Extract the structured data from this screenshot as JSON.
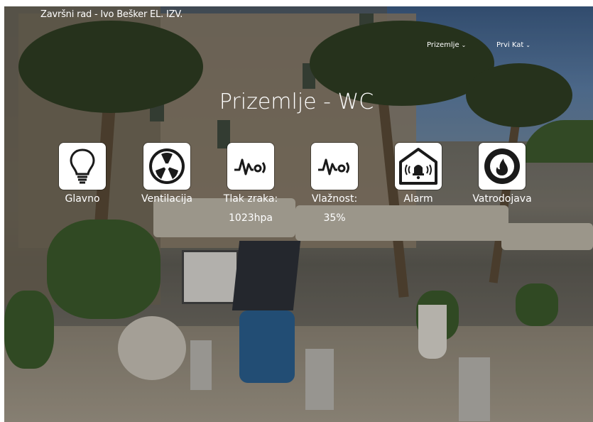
{
  "header": {
    "site_title": "Završni rad - Ivo Bešker EL. IZV.",
    "nav": [
      {
        "label": "Prizemlje"
      },
      {
        "label": "Prvi Kat"
      }
    ]
  },
  "main": {
    "page_title": "Prizemlje - WC",
    "tiles": [
      {
        "icon": "lightbulb-icon",
        "label": "Glavno",
        "value": ""
      },
      {
        "icon": "fan-icon",
        "label": "Ventilacija",
        "value": ""
      },
      {
        "icon": "pressure-wave-icon",
        "label": "Tlak zraka:",
        "value": "1023hpa"
      },
      {
        "icon": "humidity-wave-icon",
        "label": "Vlažnost:",
        "value": "35%"
      },
      {
        "icon": "alarm-bell-house-icon",
        "label": "Alarm",
        "value": ""
      },
      {
        "icon": "fire-icon",
        "label": "Vatrodojava",
        "value": ""
      }
    ]
  },
  "colors": {
    "tile_bg": "#ffffff",
    "icon": "#1a1a1a",
    "text": "#ffffff"
  }
}
